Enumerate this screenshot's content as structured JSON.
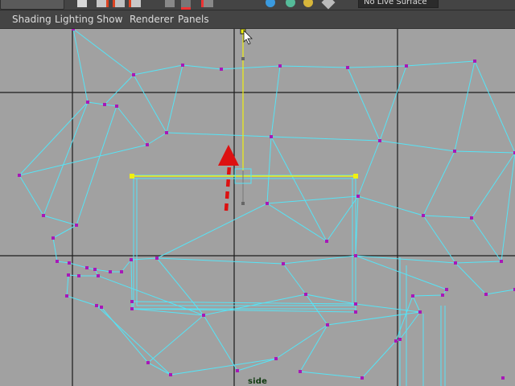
{
  "toolbar": {
    "search_field_value": "No Live Surface",
    "icons": [
      "new-scene-icon",
      "select-tool-icon",
      "lasso-tool-icon",
      "paint-select-icon",
      "grid-snap-icon",
      "curve-snap-icon",
      "point-snap-icon",
      "surface-snap-icon",
      "live-surface-icon"
    ]
  },
  "menu": {
    "shading": "Shading",
    "lighting": "Lighting",
    "show": "Show",
    "renderer": "Renderer",
    "panels": "Panels"
  },
  "viewport": {
    "camera_label": "side",
    "background_color": "#a1a1a1",
    "wire_color": "#56e4f6",
    "vertex_color": "#a818b8",
    "selected_color": "#f0f010",
    "grid_axis_color": "#1c1c1c",
    "grid_line_color": "#6a6a6a",
    "annotation_arrow_color": "#dd1111",
    "move_direction": "up"
  }
}
